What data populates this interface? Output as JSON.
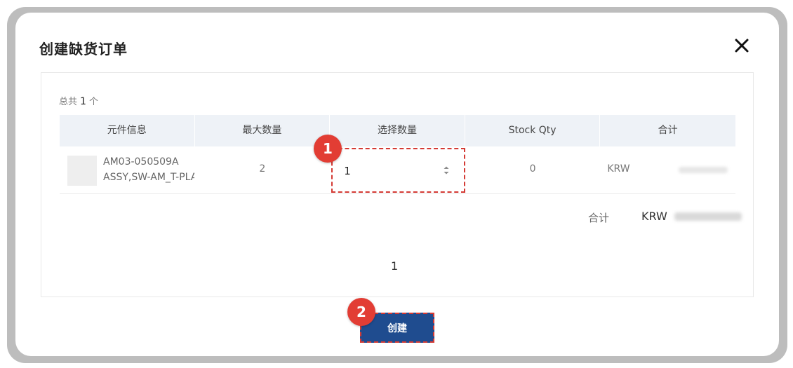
{
  "modal": {
    "title": "创建缺货订单"
  },
  "summary": {
    "total_prefix": "总共",
    "total_count": "1",
    "total_suffix": "个"
  },
  "table": {
    "headers": [
      "元件信息",
      "最大数量",
      "选择数量",
      "Stock Qty",
      "合计"
    ],
    "rows": [
      {
        "part_no": "AM03-050509A",
        "part_desc": "ASSY,SW-AM_T-PLAI",
        "max_qty": "2",
        "selected_qty": "1",
        "stock_qty": "0",
        "currency": "KRW"
      }
    ]
  },
  "footer_total": {
    "label": "合计",
    "currency": "KRW"
  },
  "pagination": {
    "current_page": "1"
  },
  "actions": {
    "create_label": "创建"
  },
  "annotations": {
    "badge_1": "1",
    "badge_2": "2"
  },
  "colors": {
    "primary_button": "#1f4c8f",
    "annotation_red": "#e23d34",
    "header_bg": "#eef2f7"
  }
}
